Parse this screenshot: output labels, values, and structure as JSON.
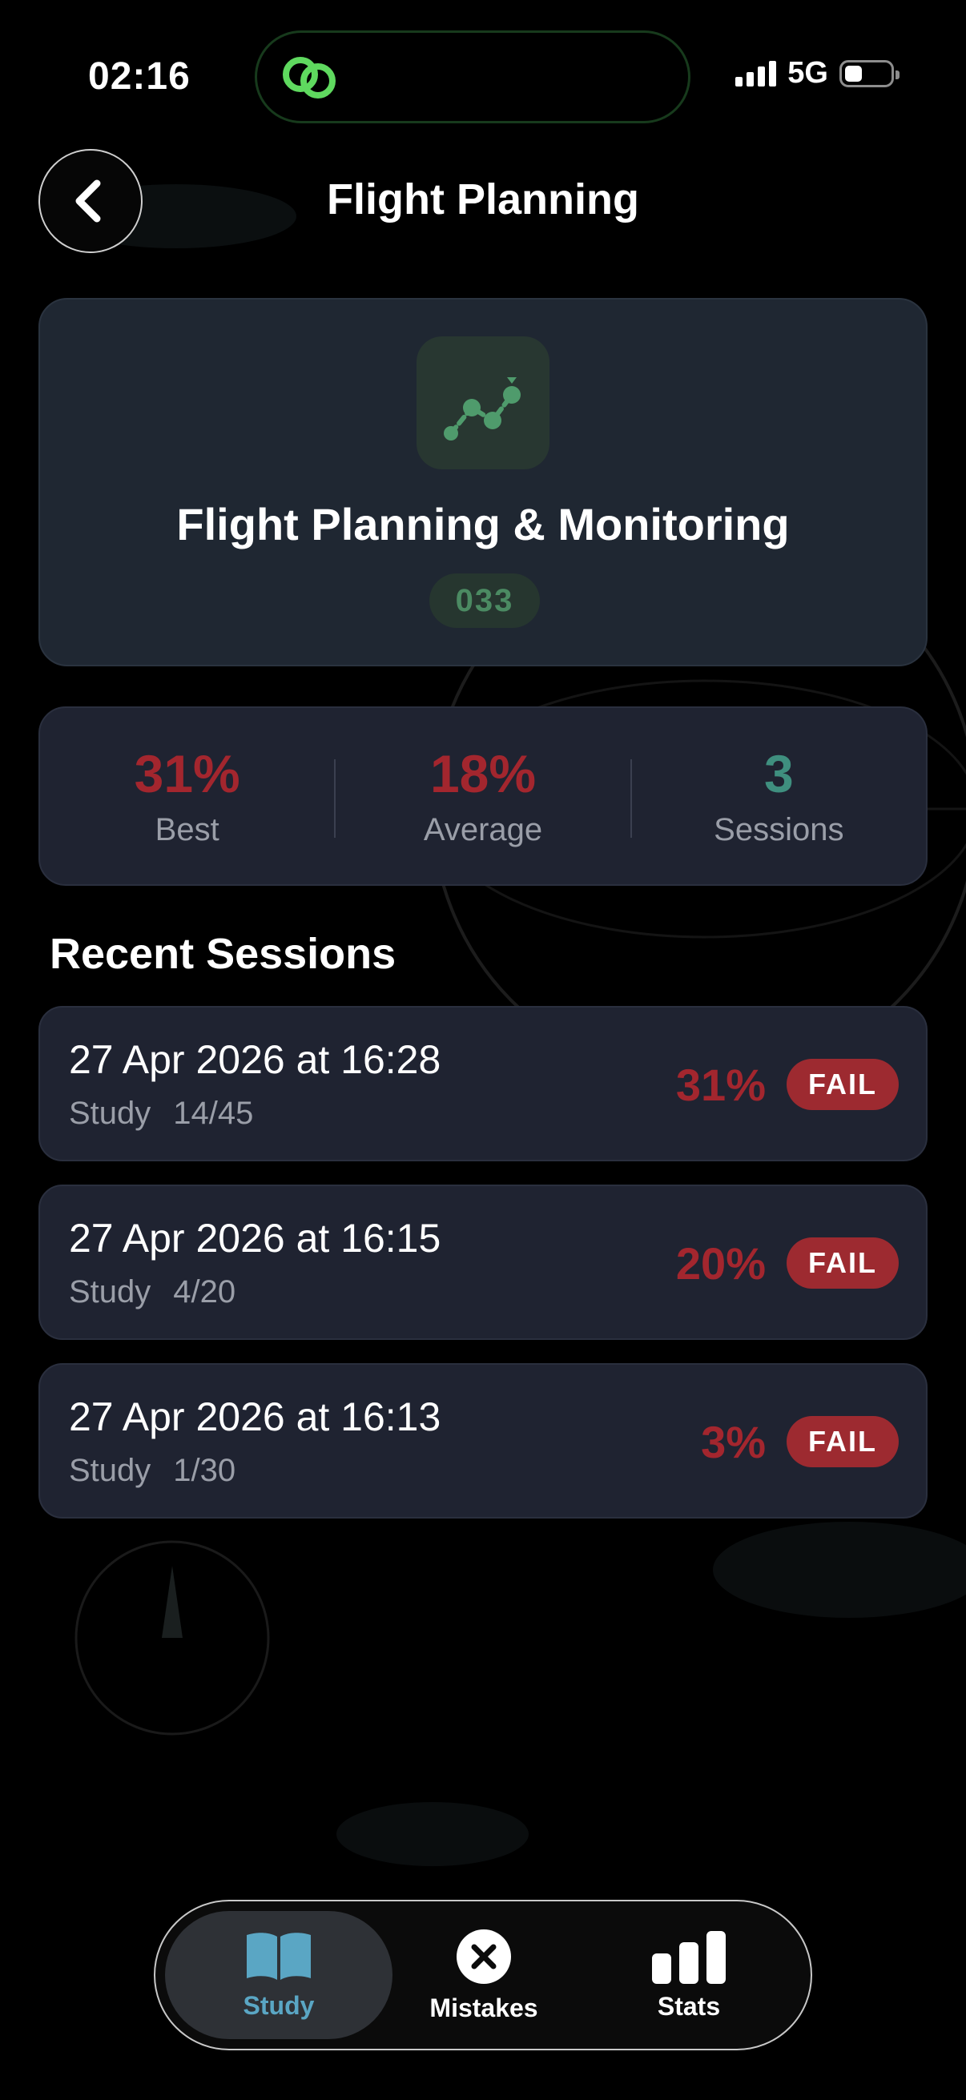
{
  "status_bar": {
    "time": "02:16",
    "network": "5G"
  },
  "header": {
    "title": "Flight Planning"
  },
  "topic": {
    "title": "Flight Planning & Monitoring",
    "code": "033"
  },
  "stats": [
    {
      "value": "31%",
      "label": "Best",
      "color": "#a3262e"
    },
    {
      "value": "18%",
      "label": "Average",
      "color": "#a3262e"
    },
    {
      "value": "3",
      "label": "Sessions",
      "color": "#3f8f7f"
    }
  ],
  "recent": {
    "title": "Recent Sessions",
    "sessions": [
      {
        "date": "27 Apr 2026 at 16:28",
        "mode": "Study",
        "count": "14/45",
        "score": "31%",
        "result": "FAIL"
      },
      {
        "date": "27 Apr 2026 at 16:15",
        "mode": "Study",
        "count": "4/20",
        "score": "20%",
        "result": "FAIL"
      },
      {
        "date": "27 Apr 2026 at 16:13",
        "mode": "Study",
        "count": "1/30",
        "score": "3%",
        "result": "FAIL"
      }
    ]
  },
  "tabbar": {
    "study": "Study",
    "mistakes": "Mistakes",
    "stats": "Stats"
  },
  "colors": {
    "fail": "#9d2a30",
    "accent_green": "#4b8a62",
    "tab_active": "#5aa6c4"
  }
}
